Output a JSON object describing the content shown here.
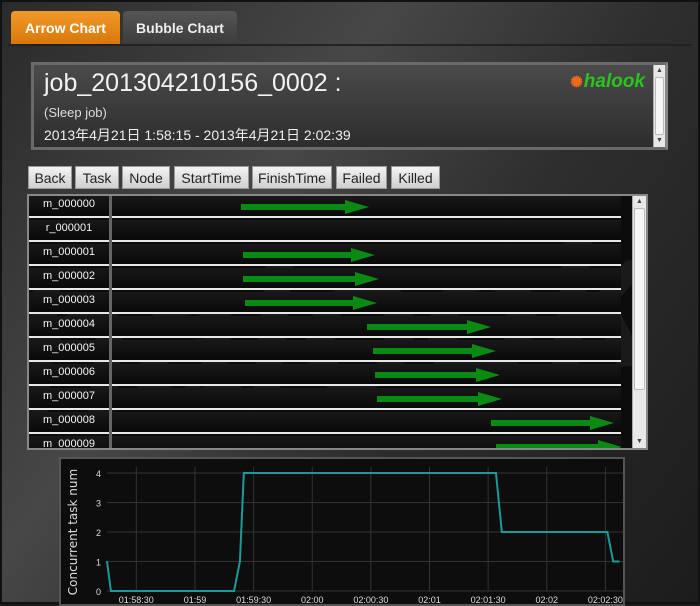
{
  "tabs": [
    {
      "label": "Arrow Chart",
      "active": true
    },
    {
      "label": "Bubble Chart",
      "active": false
    }
  ],
  "header": {
    "title": "job_201304210156_0002 :",
    "job_type": "(Sleep job)",
    "time_range": "2013年4月21日 1:58:15 - 2013年4月21日 2:02:39",
    "logo": "halook"
  },
  "buttons": [
    "Back",
    "Task",
    "Node",
    "StartTime",
    "FinishTime",
    "Failed",
    "Killed"
  ],
  "colors": {
    "accent_tab": "#e8870f",
    "arrow": "#0a8a12",
    "line": "#1a9a9a",
    "logo": "#29c41e"
  },
  "arrow_chart": {
    "watermark": "halook",
    "tasks": [
      {
        "name": "m_000000",
        "start": "01:59:22",
        "end": "02:00:28"
      },
      {
        "name": "r_000001",
        "start": null,
        "end": null
      },
      {
        "name": "m_000001",
        "start": "01:59:23",
        "end": "02:00:31"
      },
      {
        "name": "m_000002",
        "start": "01:59:23",
        "end": "02:00:33"
      },
      {
        "name": "m_000003",
        "start": "01:59:24",
        "end": "02:00:32"
      },
      {
        "name": "m_000004",
        "start": "02:00:27",
        "end": "02:01:31"
      },
      {
        "name": "m_000005",
        "start": "02:00:30",
        "end": "02:01:34"
      },
      {
        "name": "m_000006",
        "start": "02:00:31",
        "end": "02:01:36"
      },
      {
        "name": "m_000007",
        "start": "02:00:32",
        "end": "02:01:37"
      },
      {
        "name": "m_000008",
        "start": "02:01:31",
        "end": "02:02:35"
      },
      {
        "name": "m_000009",
        "start": "02:01:34",
        "end": "02:02:39"
      }
    ]
  },
  "chart_data": {
    "type": "line",
    "title": "",
    "xlabel": "",
    "ylabel": "Concurrent task num",
    "xlim": [
      "01:58:15",
      "02:02:39"
    ],
    "ylim": [
      0,
      4
    ],
    "grid": true,
    "x_ticks": [
      "01:58:30",
      "01:59",
      "01:59:30",
      "02:00",
      "02:00:30",
      "02:01",
      "02:01:30",
      "02:02",
      "02:02:30"
    ],
    "y_ticks": [
      0,
      1,
      2,
      3,
      4
    ],
    "series": [
      {
        "points": [
          [
            "01:58:15",
            1
          ],
          [
            "01:58:17",
            0
          ],
          [
            "01:59:20",
            0
          ],
          [
            "01:59:23",
            1
          ],
          [
            "01:59:25",
            4
          ],
          [
            "02:01:34",
            4
          ],
          [
            "02:01:37",
            2
          ],
          [
            "02:02:31",
            2
          ],
          [
            "02:02:34",
            1
          ],
          [
            "02:02:37",
            1
          ]
        ]
      }
    ]
  }
}
